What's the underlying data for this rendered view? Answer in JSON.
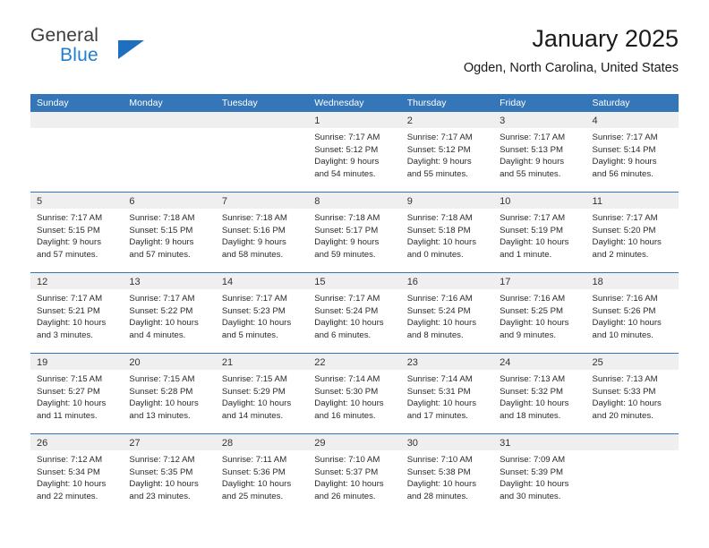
{
  "brand": {
    "name_top": "General",
    "name_bottom": "Blue",
    "accent_color": "#1f7fd0",
    "triangle_color": "#1f6fc0"
  },
  "header": {
    "title": "January 2025",
    "subtitle": "Ogden, North Carolina, United States"
  },
  "theme": {
    "header_row_bg": "#3576b9",
    "header_row_text": "#ffffff",
    "day_band_bg": "#efefef",
    "cell_bg": "#ffffff",
    "row_divider": "#3576b9"
  },
  "calendar": {
    "weekday_headers": [
      "Sunday",
      "Monday",
      "Tuesday",
      "Wednesday",
      "Thursday",
      "Friday",
      "Saturday"
    ],
    "weeks": [
      [
        {
          "date": "",
          "lines": []
        },
        {
          "date": "",
          "lines": []
        },
        {
          "date": "",
          "lines": []
        },
        {
          "date": "1",
          "lines": [
            "Sunrise: 7:17 AM",
            "Sunset: 5:12 PM",
            "Daylight: 9 hours",
            "and 54 minutes."
          ]
        },
        {
          "date": "2",
          "lines": [
            "Sunrise: 7:17 AM",
            "Sunset: 5:12 PM",
            "Daylight: 9 hours",
            "and 55 minutes."
          ]
        },
        {
          "date": "3",
          "lines": [
            "Sunrise: 7:17 AM",
            "Sunset: 5:13 PM",
            "Daylight: 9 hours",
            "and 55 minutes."
          ]
        },
        {
          "date": "4",
          "lines": [
            "Sunrise: 7:17 AM",
            "Sunset: 5:14 PM",
            "Daylight: 9 hours",
            "and 56 minutes."
          ]
        }
      ],
      [
        {
          "date": "5",
          "lines": [
            "Sunrise: 7:17 AM",
            "Sunset: 5:15 PM",
            "Daylight: 9 hours",
            "and 57 minutes."
          ]
        },
        {
          "date": "6",
          "lines": [
            "Sunrise: 7:18 AM",
            "Sunset: 5:15 PM",
            "Daylight: 9 hours",
            "and 57 minutes."
          ]
        },
        {
          "date": "7",
          "lines": [
            "Sunrise: 7:18 AM",
            "Sunset: 5:16 PM",
            "Daylight: 9 hours",
            "and 58 minutes."
          ]
        },
        {
          "date": "8",
          "lines": [
            "Sunrise: 7:18 AM",
            "Sunset: 5:17 PM",
            "Daylight: 9 hours",
            "and 59 minutes."
          ]
        },
        {
          "date": "9",
          "lines": [
            "Sunrise: 7:18 AM",
            "Sunset: 5:18 PM",
            "Daylight: 10 hours",
            "and 0 minutes."
          ]
        },
        {
          "date": "10",
          "lines": [
            "Sunrise: 7:17 AM",
            "Sunset: 5:19 PM",
            "Daylight: 10 hours",
            "and 1 minute."
          ]
        },
        {
          "date": "11",
          "lines": [
            "Sunrise: 7:17 AM",
            "Sunset: 5:20 PM",
            "Daylight: 10 hours",
            "and 2 minutes."
          ]
        }
      ],
      [
        {
          "date": "12",
          "lines": [
            "Sunrise: 7:17 AM",
            "Sunset: 5:21 PM",
            "Daylight: 10 hours",
            "and 3 minutes."
          ]
        },
        {
          "date": "13",
          "lines": [
            "Sunrise: 7:17 AM",
            "Sunset: 5:22 PM",
            "Daylight: 10 hours",
            "and 4 minutes."
          ]
        },
        {
          "date": "14",
          "lines": [
            "Sunrise: 7:17 AM",
            "Sunset: 5:23 PM",
            "Daylight: 10 hours",
            "and 5 minutes."
          ]
        },
        {
          "date": "15",
          "lines": [
            "Sunrise: 7:17 AM",
            "Sunset: 5:24 PM",
            "Daylight: 10 hours",
            "and 6 minutes."
          ]
        },
        {
          "date": "16",
          "lines": [
            "Sunrise: 7:16 AM",
            "Sunset: 5:24 PM",
            "Daylight: 10 hours",
            "and 8 minutes."
          ]
        },
        {
          "date": "17",
          "lines": [
            "Sunrise: 7:16 AM",
            "Sunset: 5:25 PM",
            "Daylight: 10 hours",
            "and 9 minutes."
          ]
        },
        {
          "date": "18",
          "lines": [
            "Sunrise: 7:16 AM",
            "Sunset: 5:26 PM",
            "Daylight: 10 hours",
            "and 10 minutes."
          ]
        }
      ],
      [
        {
          "date": "19",
          "lines": [
            "Sunrise: 7:15 AM",
            "Sunset: 5:27 PM",
            "Daylight: 10 hours",
            "and 11 minutes."
          ]
        },
        {
          "date": "20",
          "lines": [
            "Sunrise: 7:15 AM",
            "Sunset: 5:28 PM",
            "Daylight: 10 hours",
            "and 13 minutes."
          ]
        },
        {
          "date": "21",
          "lines": [
            "Sunrise: 7:15 AM",
            "Sunset: 5:29 PM",
            "Daylight: 10 hours",
            "and 14 minutes."
          ]
        },
        {
          "date": "22",
          "lines": [
            "Sunrise: 7:14 AM",
            "Sunset: 5:30 PM",
            "Daylight: 10 hours",
            "and 16 minutes."
          ]
        },
        {
          "date": "23",
          "lines": [
            "Sunrise: 7:14 AM",
            "Sunset: 5:31 PM",
            "Daylight: 10 hours",
            "and 17 minutes."
          ]
        },
        {
          "date": "24",
          "lines": [
            "Sunrise: 7:13 AM",
            "Sunset: 5:32 PM",
            "Daylight: 10 hours",
            "and 18 minutes."
          ]
        },
        {
          "date": "25",
          "lines": [
            "Sunrise: 7:13 AM",
            "Sunset: 5:33 PM",
            "Daylight: 10 hours",
            "and 20 minutes."
          ]
        }
      ],
      [
        {
          "date": "26",
          "lines": [
            "Sunrise: 7:12 AM",
            "Sunset: 5:34 PM",
            "Daylight: 10 hours",
            "and 22 minutes."
          ]
        },
        {
          "date": "27",
          "lines": [
            "Sunrise: 7:12 AM",
            "Sunset: 5:35 PM",
            "Daylight: 10 hours",
            "and 23 minutes."
          ]
        },
        {
          "date": "28",
          "lines": [
            "Sunrise: 7:11 AM",
            "Sunset: 5:36 PM",
            "Daylight: 10 hours",
            "and 25 minutes."
          ]
        },
        {
          "date": "29",
          "lines": [
            "Sunrise: 7:10 AM",
            "Sunset: 5:37 PM",
            "Daylight: 10 hours",
            "and 26 minutes."
          ]
        },
        {
          "date": "30",
          "lines": [
            "Sunrise: 7:10 AM",
            "Sunset: 5:38 PM",
            "Daylight: 10 hours",
            "and 28 minutes."
          ]
        },
        {
          "date": "31",
          "lines": [
            "Sunrise: 7:09 AM",
            "Sunset: 5:39 PM",
            "Daylight: 10 hours",
            "and 30 minutes."
          ]
        },
        {
          "date": "",
          "lines": []
        }
      ]
    ]
  }
}
